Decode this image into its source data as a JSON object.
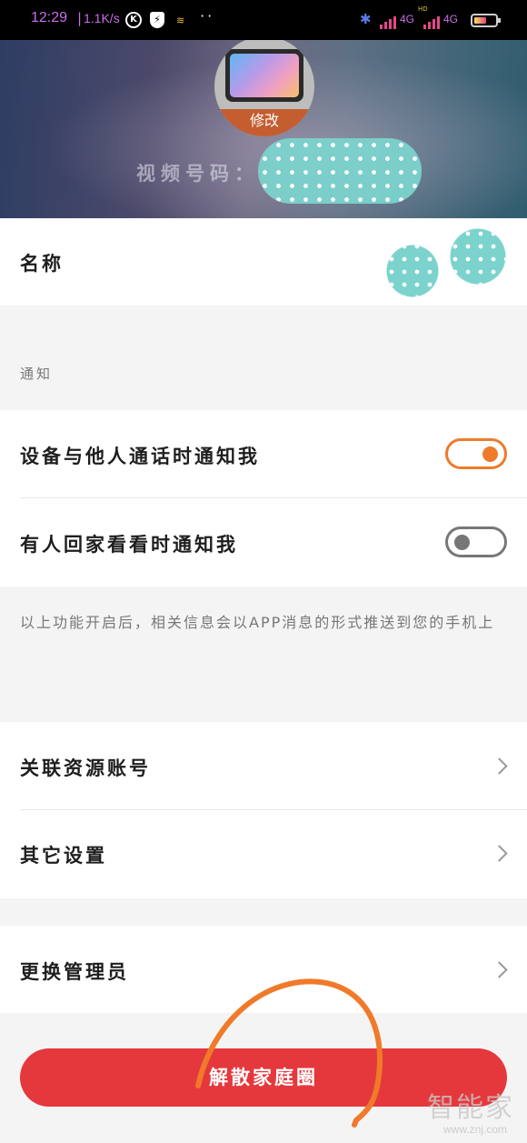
{
  "status_bar": {
    "time": "12:29",
    "separator": "|",
    "net_speed": "1.1K/s",
    "k_icon_text": "K",
    "network_label_1": "4G",
    "network_label_2": "4G",
    "hd_label": "HD",
    "icons": [
      "k-circle-icon",
      "bolt-shield-icon",
      "wifi-small-icon",
      "more-dots-icon",
      "bluetooth-icon",
      "signal-bars-icon",
      "battery-icon"
    ],
    "colors": {
      "time": "#c86fe8",
      "signal": "#e4478a",
      "bluetooth": "#5b7be8"
    }
  },
  "header": {
    "avatar_edit_label": "修改",
    "video_label": "视频号码："
  },
  "name_row": {
    "label": "名称"
  },
  "notifications": {
    "section_title": "通知",
    "items": [
      {
        "label": "设备与他人通话时通知我",
        "enabled": true
      },
      {
        "label": "有人回家看看时通知我",
        "enabled": false
      }
    ],
    "hint": "以上功能开启后，相关信息会以APP消息的形式推送到您的手机上"
  },
  "menu": {
    "linked_accounts": "关联资源账号",
    "other_settings": "其它设置",
    "change_admin": "更换管理员"
  },
  "disband_button": {
    "label": "解散家庭圈",
    "color": "#e5383d"
  },
  "accent_color": "#ee7b2a",
  "watermark": {
    "text": "智能家",
    "url": "www.znj.com"
  }
}
